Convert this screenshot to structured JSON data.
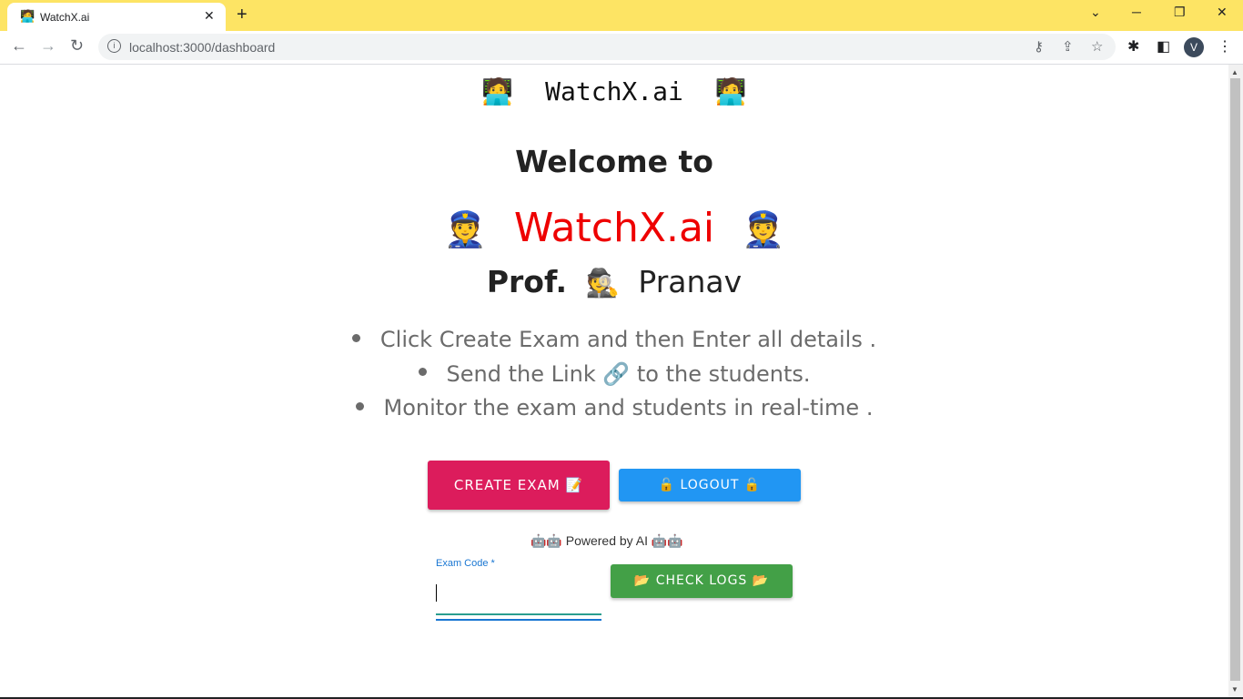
{
  "browser": {
    "tab_favicon": "🧑‍💻",
    "tab_title": "WatchX.ai",
    "tab_close": "✕",
    "new_tab": "+",
    "url": "localhost:3000/dashboard",
    "avatar_letter": "V"
  },
  "page": {
    "brand_top": {
      "emoji_left": "🧑‍💻",
      "text": "WatchX.ai",
      "emoji_right": "🧑‍💻"
    },
    "welcome": "Welcome to",
    "brand_big": {
      "emoji_left": "👮",
      "text": "WatchX.ai",
      "emoji_right": "👮"
    },
    "prof": {
      "title": "Prof.",
      "emoji": "🕵️",
      "name": "Pranav"
    },
    "bullets": [
      {
        "text": "Click Create Exam and then Enter all details ."
      },
      {
        "text": "Send the Link 🔗 to the students."
      },
      {
        "text": "Monitor the exam and students in real-time ."
      }
    ],
    "buttons": {
      "create_exam": "CREATE EXAM 📝",
      "logout": "🔓 LOGOUT 🔓",
      "check_logs": "📂 CHECK LOGS 📂"
    },
    "powered_by": "🤖🤖 Powered by AI 🤖🤖",
    "exam_code": {
      "label": "Exam Code *",
      "value": ""
    }
  },
  "colors": {
    "tabbar": "#fde464",
    "brand_red": "#ee0000",
    "create_exam": "#dc1c5c",
    "logout": "#2196f3",
    "check_logs": "#43a047",
    "field_accent": "#1976d2"
  }
}
